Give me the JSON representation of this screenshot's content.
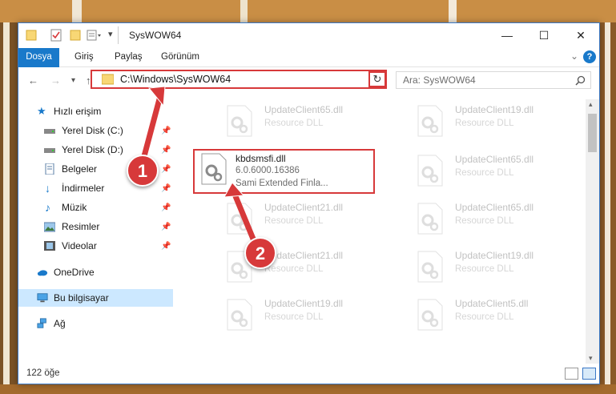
{
  "window": {
    "title": "SysWOW64",
    "minimize": "—",
    "maximize": "☐",
    "close": "✕"
  },
  "ribbon": {
    "tabs": [
      {
        "label": "Dosya"
      },
      {
        "label": "Giriş"
      },
      {
        "label": "Paylaş"
      },
      {
        "label": "Görünüm"
      }
    ],
    "expand": "⌄",
    "help": "?"
  },
  "address": {
    "path": "C:\\Windows\\SysWOW64",
    "refresh": "↻",
    "dropdown": "⌄",
    "search_placeholder": "Ara: SysWOW64"
  },
  "nav": {
    "quick_access": "Hızlı erişim",
    "items": [
      {
        "label": "Yerel Disk (C:)",
        "icon": "drive-icon"
      },
      {
        "label": "Yerel Disk (D:)",
        "icon": "drive-icon"
      },
      {
        "label": "Belgeler",
        "icon": "documents-icon"
      },
      {
        "label": "İndirmeler",
        "icon": "downloads-icon"
      },
      {
        "label": "Müzik",
        "icon": "music-icon"
      },
      {
        "label": "Resimler",
        "icon": "pictures-icon"
      },
      {
        "label": "Videolar",
        "icon": "videos-icon"
      }
    ],
    "onedrive": "OneDrive",
    "this_pc": "Bu bilgisayar",
    "network": "Ağ"
  },
  "files": {
    "highlighted": {
      "name": "kbdsmsfi.dll",
      "version": "6.0.6000.16386",
      "description": "Sami Extended Finla..."
    },
    "background": [
      {
        "name": "UpdateClient65.dll",
        "type": "Resource DLL"
      },
      {
        "name": "UpdateClient19.dll",
        "type": "Resource DLL"
      },
      {
        "name": "UpdateClient65.dll",
        "type": "Resource DLL"
      },
      {
        "name": "UpdateClient21.dll",
        "type": "Resource DLL"
      },
      {
        "name": "UpdateClient65.dll",
        "type": "Resource DLL"
      },
      {
        "name": "UpdateClient21.dll",
        "type": "Resource DLL"
      },
      {
        "name": "UpdateClient19.dll",
        "type": "Resource DLL"
      },
      {
        "name": "UpdateClient19.dll",
        "type": "Resource DLL"
      },
      {
        "name": "UpdateClient5.dll",
        "type": "Resource DLL"
      }
    ]
  },
  "status": {
    "count": "122 öğe"
  },
  "callouts": {
    "one": "1",
    "two": "2"
  },
  "colors": {
    "accent": "#1979ca",
    "highlight": "#d7393a",
    "selected": "#cce8ff"
  }
}
